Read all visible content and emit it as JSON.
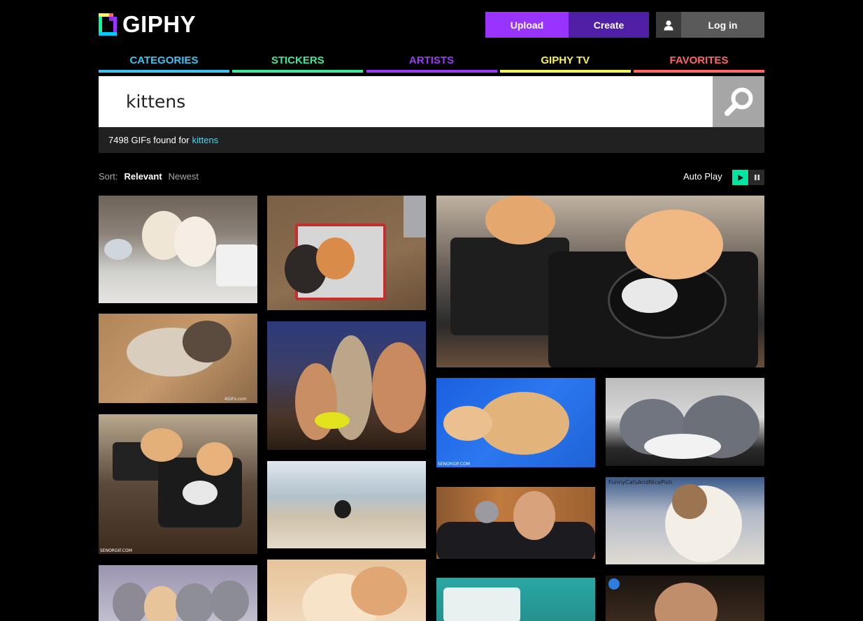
{
  "header": {
    "logo_text": "GIPHY",
    "upload_label": "Upload",
    "create_label": "Create",
    "login_label": "Log in"
  },
  "nav": {
    "items": [
      {
        "label": "CATEGORIES",
        "color": "#3ec1f3"
      },
      {
        "label": "STICKERS",
        "color": "#3ee89b"
      },
      {
        "label": "ARTISTS",
        "color": "#9b3cf3"
      },
      {
        "label": "GIPHY TV",
        "color": "#f5f25a"
      },
      {
        "label": "FAVORITES",
        "color": "#ff6666"
      }
    ]
  },
  "search": {
    "value": "kittens"
  },
  "results": {
    "count_text": "7498 GIFs found for",
    "term": "kittens"
  },
  "sort": {
    "label": "Sort:",
    "relevant": "Relevant",
    "newest": "Newest"
  },
  "autoplay": {
    "label": "Auto Play"
  },
  "gifs": {
    "watermark_4gifs": "4GIFs.com",
    "watermark_senor_1": "SENORGIF.COM",
    "watermark_senor_2": "SENORGIF.COM",
    "watermark_funny": "FunnyCatsAndNicePish"
  },
  "colors": {
    "upload": "#9933ff",
    "create": "#4f1fa6",
    "autoplay_on": "#00e6a0",
    "result_term": "#5ad1e6"
  }
}
